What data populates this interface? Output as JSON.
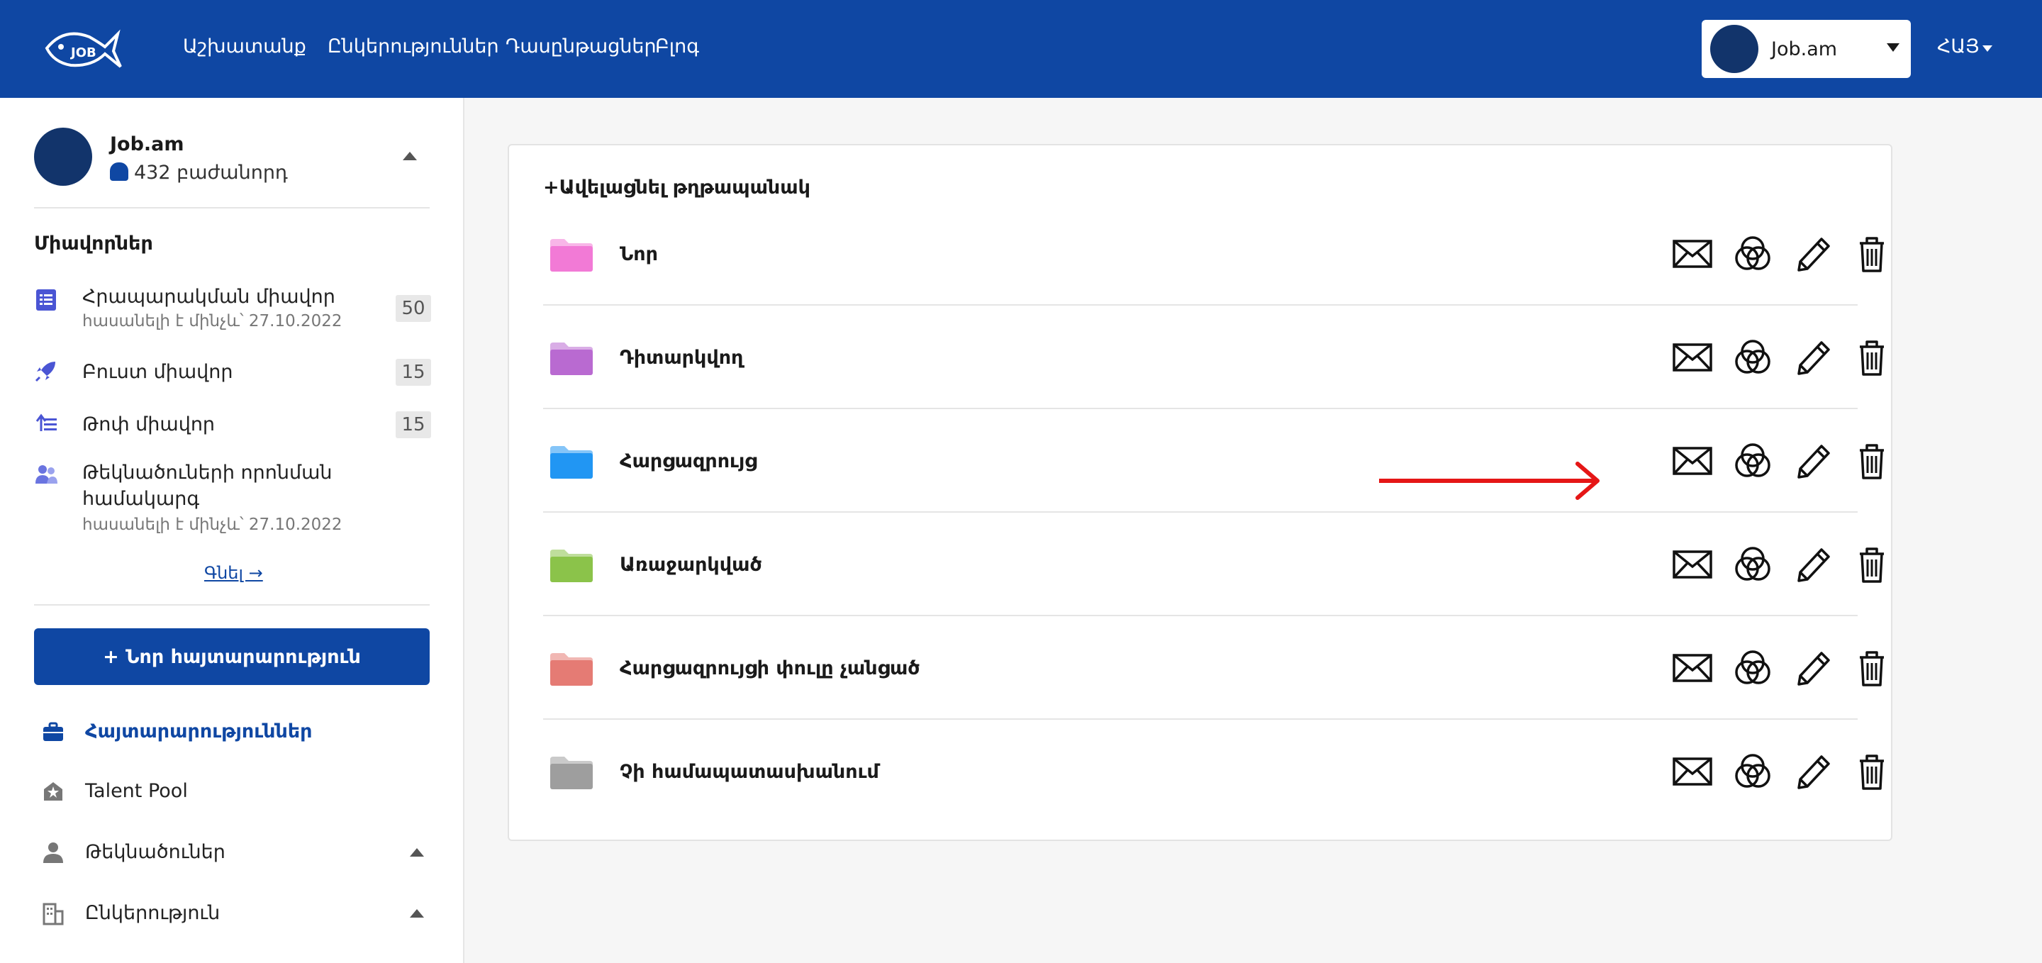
{
  "nav": {
    "links": [
      "Աշխատանք",
      "Ընկերություններ",
      "Դասընթացներ",
      "Բլոգ"
    ],
    "company_select": "Job.am",
    "language": "ՀԱՅ"
  },
  "sidebar": {
    "company_name": "Job.am",
    "followers": "432 բաժանորդ",
    "section_title": "Միավորներ",
    "units": [
      {
        "title": "Հրապարակման միավոր",
        "sub": "հասանելի է մինչև՝ 27.10.2022",
        "count": "50"
      },
      {
        "title": "Բուստ միավոր",
        "count": "15"
      },
      {
        "title": "Թոփ միավոր",
        "count": "15"
      },
      {
        "title": "Թեկնածուների որոնման",
        "title2": "համակարգ",
        "sub": "հասանելի է մինչև՝ 27.10.2022"
      }
    ],
    "more_link": "Գնել →",
    "new_button": "+ Նոր հայտարարություն",
    "menu": [
      {
        "label": "Հայտարարություններ",
        "active": true
      },
      {
        "label": "Talent Pool"
      },
      {
        "label": "Թեկնածուներ"
      },
      {
        "label": "Ընկերություն"
      }
    ]
  },
  "main": {
    "add_folder": "+Ավելացնել թղթապանակ",
    "folders": [
      {
        "name": "Նոր",
        "color": "#f27ad6"
      },
      {
        "name": "Դիտարկվող",
        "color": "#b96ad1"
      },
      {
        "name": "Հարցազրույց",
        "color": "#2196f3"
      },
      {
        "name": "Առաջարկված",
        "color": "#8bc34a"
      },
      {
        "name": "Հարցազրույցի փուլը չանցած",
        "color": "#e57b74"
      },
      {
        "name": "Չի համապատասխանում",
        "color": "#9e9e9e"
      }
    ]
  },
  "colors": {
    "brand": "#0f47a3",
    "arrow": "#e51616"
  }
}
